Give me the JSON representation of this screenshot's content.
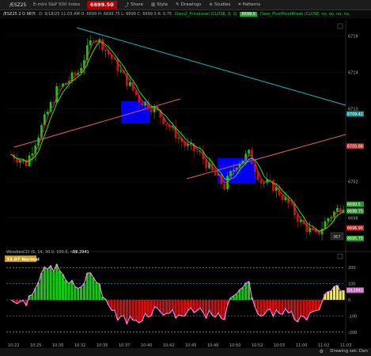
{
  "toolbar": {
    "symbol": "/ESZ25",
    "instrument_name": "E-mini S&P 500 Index ...",
    "price": "6699.50",
    "share_label": "Share",
    "style_label": "Style",
    "drawings_label": "Drawings",
    "studies_label": "Studies",
    "patterns_label": "Patterns"
  },
  "info_line": {
    "symbol_period": "/ESZ25 2 D 987t",
    "ohlc": "D: 9/18/25 11:03 AM  O: 6699  H: 6699.75  L: 6699  C: 6699.5  R: 0.75",
    "study1": "Dans2_PriceLevel (CLOSE, 0, 1)",
    "study1_value": "6699.5",
    "study2": "Dans_PivotPointBreak (CLOSE, no, no, no, no,"
  },
  "price_axis": {
    "ticks": [
      "6718",
      "6714",
      "6710",
      "6706",
      "6702",
      "6698"
    ],
    "tick_values": [
      6718,
      6714,
      6710,
      6706,
      6702,
      6698
    ],
    "labels": [
      {
        "text": "6709.42",
        "value": 6709.42,
        "color": "#1a8a8a"
      },
      {
        "text": "6705.88",
        "value": 6705.88,
        "color": "#c03030"
      },
      {
        "text": "6699.5",
        "value": 6699.5,
        "color": "#2a9a2a"
      },
      {
        "text": "6698.75",
        "value": 6698.75,
        "color": "#2a9a2a"
      },
      {
        "text": "6696.90",
        "value": 6696.9,
        "color": "#c02020"
      },
      {
        "text": "6695.75",
        "value": 6695.75,
        "color": "#2a9a2a"
      }
    ],
    "tick_count_badge": "367"
  },
  "time_axis": [
    "10:22",
    "10:25",
    "10:30",
    "10:32",
    "10:35",
    "10:37",
    "10:40",
    "10:42",
    "10:45",
    "10:46",
    "10:50",
    "10:52",
    "10:55",
    "11:00",
    "11:02",
    "11:03"
  ],
  "indicator": {
    "name": "WoodiesCCI (6, 14, 30.0, 100.0, no)",
    "value": "59.2941",
    "regime_label": "33.07 Normal",
    "ticks": [
      "200",
      "100",
      "0",
      "-100",
      "-200"
    ],
    "tick_values": [
      200,
      100,
      0,
      -100,
      -200
    ],
    "value_label": "59.2941"
  },
  "status": {
    "drawing_set": "Drawing set: Dan"
  },
  "colors": {
    "up": "#11cc11",
    "down": "#cc1111",
    "trendline_cyan": "#22bbbb",
    "trendline_salmon": "#e06060",
    "zone": "#0000ff",
    "cci_line": "#ff88ff"
  }
}
